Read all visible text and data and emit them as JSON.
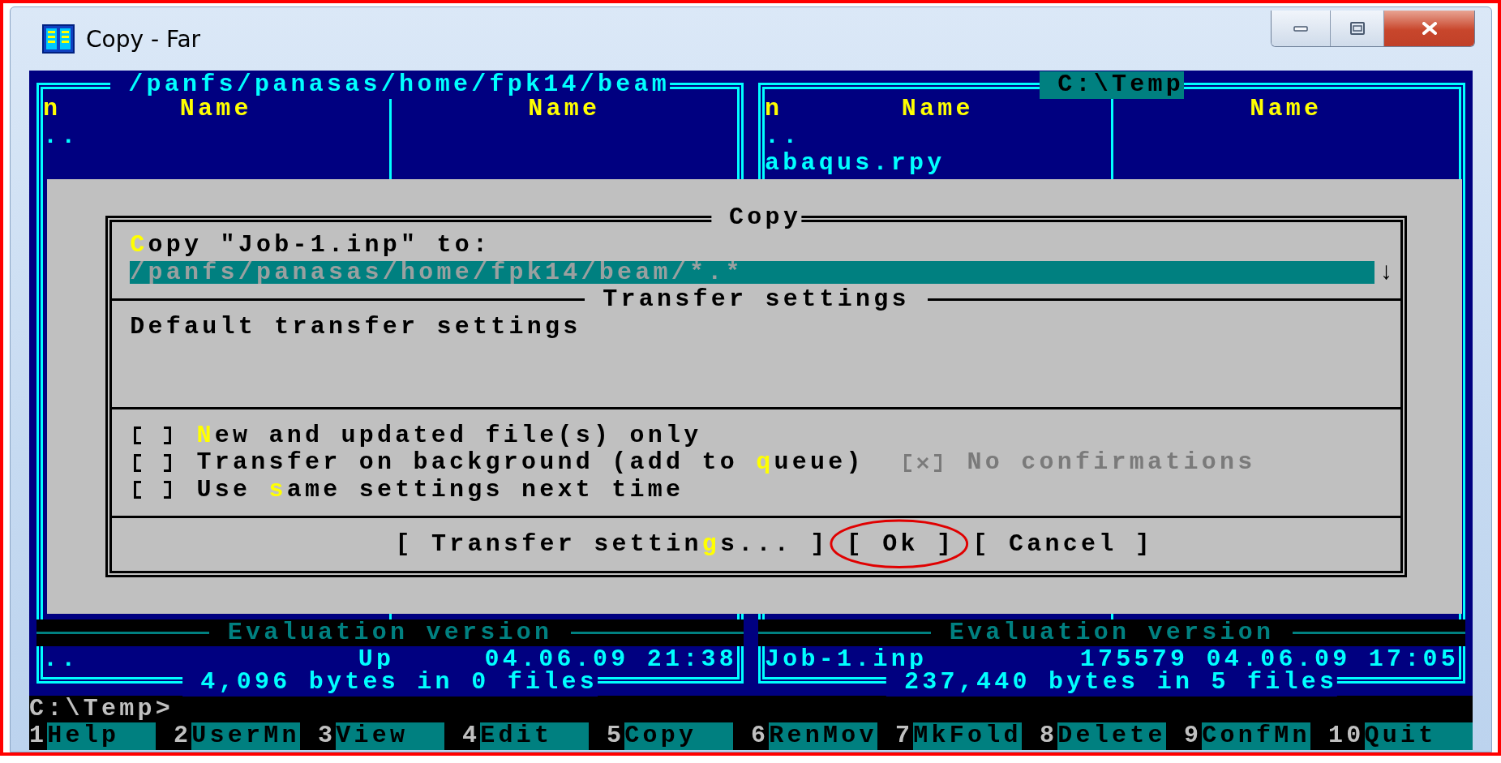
{
  "window": {
    "title": "Copy - Far"
  },
  "window_controls": [
    {
      "kind": "minimize"
    },
    {
      "kind": "maximize"
    },
    {
      "kind": "close"
    }
  ],
  "panels": [
    {
      "title": "/panfs/panasas/home/fpk14/beam",
      "selected": false,
      "sort_mark": "n",
      "headers": [
        "Name",
        "Name"
      ],
      "files": [
        ".."
      ],
      "footer_label": "Evaluation version",
      "current_file": {
        "name": "..",
        "size": "Up",
        "date": "04.06.09",
        "time": "21:38"
      },
      "summary": "4,096 bytes in 0 files"
    },
    {
      "title": "C:\\Temp",
      "selected": true,
      "sort_mark": "n",
      "headers": [
        "Name",
        "Name"
      ],
      "files": [
        "..",
        "abaqus.rpy"
      ],
      "footer_label": "Evaluation version",
      "current_file": {
        "name": "Job-1.inp",
        "size": "175579",
        "date": "04.06.09",
        "time": "17:05"
      },
      "summary": "237,440 bytes in 5 files"
    }
  ],
  "dialog": {
    "title": "Copy",
    "prompt": {
      "hotkey": "C",
      "after": "opy \"Job-1.inp\" to:"
    },
    "target": {
      "value": "/panfs/panasas/home/fpk14/beam/*.*",
      "history_arrow": "↓"
    },
    "settings_title": "Transfer settings",
    "settings_text": "Default transfer settings",
    "option_rows": [
      {
        "options": [
          {
            "checked": false,
            "disabled": false,
            "hotkey": "N",
            "after": "ew and updated file(s) only"
          }
        ]
      },
      {
        "options": [
          {
            "checked": false,
            "disabled": false,
            "before": "Transfer on background (add to ",
            "hotkey": "q",
            "after": "ueue)"
          },
          {
            "checked": true,
            "disabled": true,
            "before": "No confirmations"
          }
        ]
      },
      {
        "options": [
          {
            "checked": false,
            "disabled": false,
            "before": "Use ",
            "hotkey": "s",
            "after": "ame settings next time"
          }
        ]
      }
    ],
    "buttons": [
      {
        "before": "[ Transfer settin",
        "hotkey": "g",
        "after": "s... ]",
        "circled": false
      },
      {
        "before": "[ Ok ]",
        "circled": true
      },
      {
        "before": "[ Cancel ]",
        "circled": false
      }
    ]
  },
  "command_line": {
    "prompt": "C:\\Temp>"
  },
  "key_bar": [
    {
      "key": "1",
      "label": "Help"
    },
    {
      "key": "2",
      "label": "UserMn"
    },
    {
      "key": "3",
      "label": "View"
    },
    {
      "key": "4",
      "label": "Edit"
    },
    {
      "key": "5",
      "label": "Copy"
    },
    {
      "key": "6",
      "label": "RenMov"
    },
    {
      "key": "7",
      "label": "MkFold"
    },
    {
      "key": "8",
      "label": "Delete"
    },
    {
      "key": "9",
      "label": "ConfMn"
    },
    {
      "key": "10",
      "label": "Quit"
    }
  ]
}
